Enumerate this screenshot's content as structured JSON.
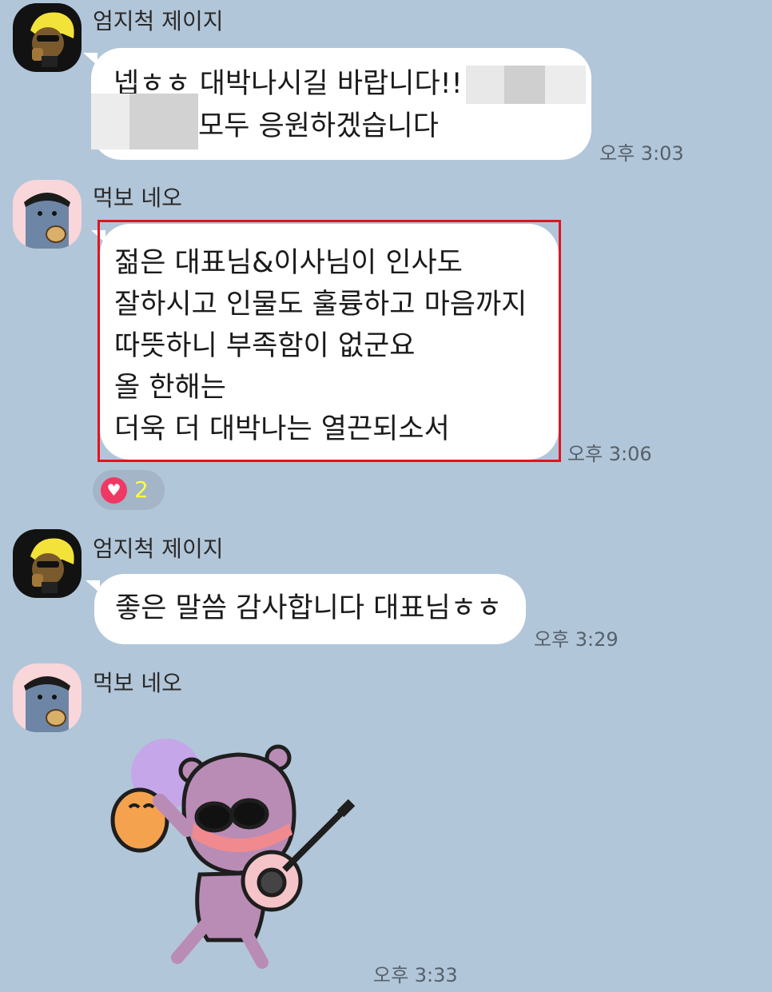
{
  "messages": [
    {
      "sender": "엄지척 제이지",
      "lines": [
        "넵ㅎㅎ 대박나시길 바랍니다!!",
        "모두 응원하겠습니다"
      ],
      "time": "오후 3:03"
    },
    {
      "sender": "먹보 네오",
      "lines": [
        "젊은 대표님&이사님이 인사도",
        "잘하시고 인물도 훌륭하고 마음까지",
        "따뜻하니 부족함이 없군요",
        "올 한해는",
        "더욱 더 대박나는 열끈되소서"
      ],
      "time": "오후 3:06",
      "reaction": {
        "icon": "heart-icon",
        "count": "2"
      }
    },
    {
      "sender": "엄지척 제이지",
      "lines": [
        "좋은 말씀 감사합니다 대표님ㅎㅎ"
      ],
      "time": "오후 3:29"
    },
    {
      "sender": "먹보 네오",
      "sticker": "guitar-sticker-icon",
      "time": "오후 3:33"
    }
  ],
  "colors": {
    "background": "#b2c6d9",
    "bubble": "#ffffff",
    "highlight_box": "#e0141e",
    "reaction_heart": "#f03865",
    "reaction_count": "#ffff3a"
  }
}
